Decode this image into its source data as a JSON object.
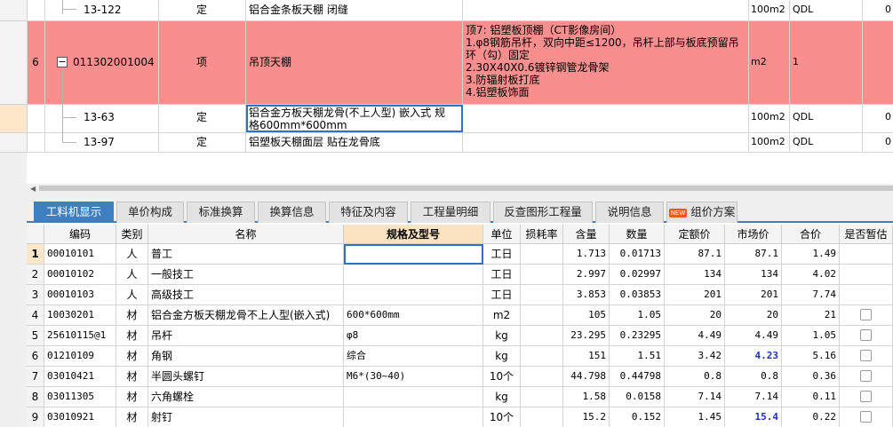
{
  "upper_rows": [
    {
      "num": "",
      "code": "13-122",
      "type": "定",
      "name": "铝合金条板天棚 闭缝",
      "feature": "",
      "unit": "100m2",
      "qty_expr": "QDL",
      "extra": "0"
    },
    {
      "num": "6",
      "code": "011302001004",
      "type": "项",
      "name": "吊顶天棚",
      "feature_lines": [
        "顶7: 铝塑板顶棚（CT影像房间）",
        "1.φ8钢筋吊杆，双向中距≤1200，吊杆上部与板底预留吊",
        "环（勾）固定",
        "2.30X40X0.6镀锌钢管龙骨架",
        "3.防辐射板打底",
        "4.铝塑板饰面"
      ],
      "unit": "m2",
      "qty_expr": "1",
      "extra": "",
      "collapse_glyph": "−"
    },
    {
      "num": "",
      "code": "13-63",
      "type": "定",
      "name_lines": [
        "铝合金方板天棚龙骨(不上人型) 嵌入式 规",
        "格600mm*600mm"
      ],
      "feature": "",
      "unit": "100m2",
      "qty_expr": "QDL",
      "extra": "0"
    },
    {
      "num": "",
      "code": "13-97",
      "type": "定",
      "name": "铝塑板天棚面层 贴在龙骨底",
      "feature": "",
      "unit": "100m2",
      "qty_expr": "QDL",
      "extra": "0"
    }
  ],
  "tabs": [
    {
      "label": "工料机显示",
      "active": true
    },
    {
      "label": "单价构成"
    },
    {
      "label": "标准换算"
    },
    {
      "label": "换算信息"
    },
    {
      "label": "特征及内容"
    },
    {
      "label": "工程量明细"
    },
    {
      "label": "反查图形工程量"
    },
    {
      "label": "说明信息"
    },
    {
      "label": "组价方案",
      "badge": "NEW"
    }
  ],
  "lower_headers": [
    "编码",
    "类别",
    "名称",
    "规格及型号",
    "单位",
    "损耗率",
    "含量",
    "数量",
    "定额价",
    "市场价",
    "合价",
    "是否暂估"
  ],
  "lower_rows": [
    {
      "num": "1",
      "code": "00010101",
      "cat": "人",
      "name": "普工",
      "spec": "",
      "unit": "工日",
      "loss": "",
      "content": "1.713",
      "qty": "0.01713",
      "quota": "87.1",
      "market": "87.1",
      "total": "1.49",
      "checkbox": false
    },
    {
      "num": "2",
      "code": "00010102",
      "cat": "人",
      "name": "一般技工",
      "spec": "",
      "unit": "工日",
      "loss": "",
      "content": "2.997",
      "qty": "0.02997",
      "quota": "134",
      "market": "134",
      "total": "4.02",
      "checkbox": false
    },
    {
      "num": "3",
      "code": "00010103",
      "cat": "人",
      "name": "高级技工",
      "spec": "",
      "unit": "工日",
      "loss": "",
      "content": "3.853",
      "qty": "0.03853",
      "quota": "201",
      "market": "201",
      "total": "7.74",
      "checkbox": false
    },
    {
      "num": "4",
      "code": "10030201",
      "cat": "材",
      "name": "铝合金方板天棚龙骨不上人型(嵌入式)",
      "spec": "600*600mm",
      "unit": "m2",
      "loss": "",
      "content": "105",
      "qty": "1.05",
      "quota": "20",
      "market": "20",
      "total": "21",
      "checkbox": true
    },
    {
      "num": "5",
      "code": "25610115@1",
      "cat": "材",
      "name": "吊杆",
      "spec": "φ8",
      "unit": "kg",
      "loss": "",
      "content": "23.295",
      "qty": "0.23295",
      "quota": "4.49",
      "market": "4.49",
      "total": "1.05",
      "checkbox": true
    },
    {
      "num": "6",
      "code": "01210109",
      "cat": "材",
      "name": "角钢",
      "spec": "综合",
      "unit": "kg",
      "loss": "",
      "content": "151",
      "qty": "1.51",
      "quota": "3.42",
      "market": "4.23",
      "market_highlight": true,
      "total": "5.16",
      "checkbox": true
    },
    {
      "num": "7",
      "code": "03010421",
      "cat": "材",
      "name": "半圆头螺钉",
      "spec": "M6*(30~40)",
      "unit": "10个",
      "loss": "",
      "content": "44.798",
      "qty": "0.44798",
      "quota": "0.8",
      "market": "0.8",
      "total": "0.36",
      "checkbox": true
    },
    {
      "num": "8",
      "code": "03011305",
      "cat": "材",
      "name": "六角螺栓",
      "spec": "",
      "unit": "kg",
      "loss": "",
      "content": "1.58",
      "qty": "0.0158",
      "quota": "7.14",
      "market": "7.14",
      "total": "0.11",
      "checkbox": true
    },
    {
      "num": "9",
      "code": "03010921",
      "cat": "材",
      "name": "射钉",
      "spec": "",
      "unit": "10个",
      "loss": "",
      "content": "15.2",
      "qty": "0.152",
      "quota": "1.45",
      "market": "15.4",
      "market_highlight": true,
      "total": "0.22",
      "checkbox": true
    }
  ],
  "colors": {
    "selected_row_bg": "#f98e8e",
    "tab_active_bg": "#3d7fc0",
    "highlight_header_bg": "#fbe3c2",
    "market_price_changed": "#1a2fd0"
  }
}
